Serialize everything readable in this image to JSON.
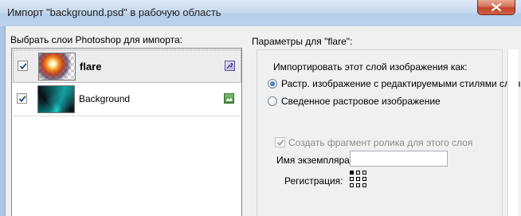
{
  "window": {
    "title": "Импорт \"background.psd\" в рабочую область"
  },
  "layers_panel": {
    "label": "Выбрать слои Photoshop для импорта:",
    "layers": [
      {
        "name": "flare",
        "checked": true,
        "selected": true,
        "type_icon": "bitmap-layer-icon"
      },
      {
        "name": "Background",
        "checked": true,
        "selected": false,
        "type_icon": "image-layer-icon"
      }
    ]
  },
  "params_panel": {
    "title": "Параметры для \"flare\":",
    "import_as_label": "Импортировать этот слой изображения как:",
    "options": [
      {
        "label": "Растр. изображение с редактируемыми стилями слоя",
        "selected": true
      },
      {
        "label": "Сведенное растровое изображение",
        "selected": false
      }
    ],
    "create_clip": {
      "label": "Создать фрагмент ролика для этого слоя",
      "checked": true,
      "disabled": true
    },
    "instance_name": {
      "label": "Имя экземпляра:",
      "value": ""
    },
    "registration": {
      "label": "Регистрация:",
      "selected_point": "top-left"
    }
  }
}
